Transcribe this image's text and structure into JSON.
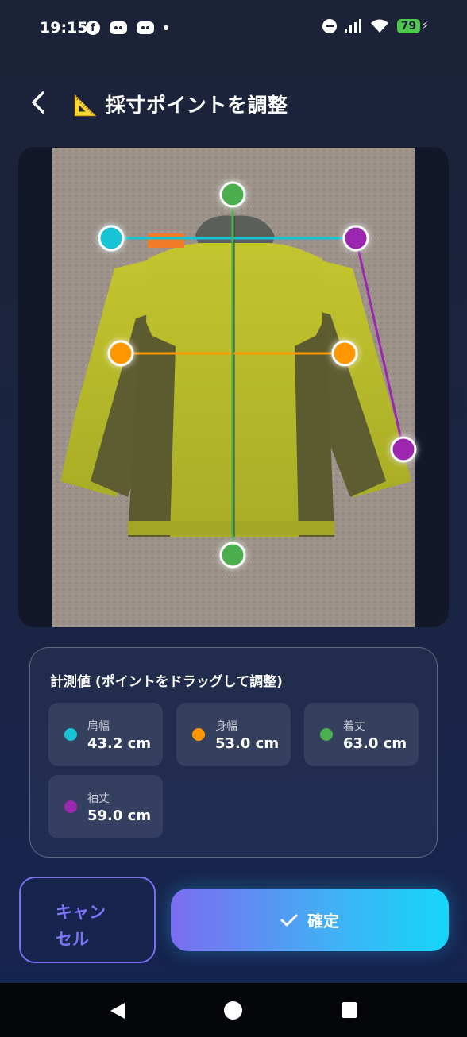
{
  "status": {
    "time": "19:15",
    "battery": "79"
  },
  "header": {
    "title": "📐 採寸ポイントを調整"
  },
  "measurements": {
    "title": "計測値 (ポイントをドラッグして調整)",
    "items": [
      {
        "label": "肩幅",
        "value": "43.2 cm",
        "color": "#17c4d6"
      },
      {
        "label": "身幅",
        "value": "53.0 cm",
        "color": "#ff9800"
      },
      {
        "label": "着丈",
        "value": "63.0 cm",
        "color": "#4caf50"
      },
      {
        "label": "袖丈",
        "value": "59.0 cm",
        "color": "#9c27b0"
      }
    ]
  },
  "actions": {
    "cancel_label": "キャンセル",
    "confirm_label": "確定"
  },
  "icons": {
    "back": "chevron-left-icon",
    "confirm": "check-icon",
    "nav_back": "triangle-back-icon",
    "nav_home": "circle-home-icon",
    "nav_recent": "square-recent-icon"
  }
}
